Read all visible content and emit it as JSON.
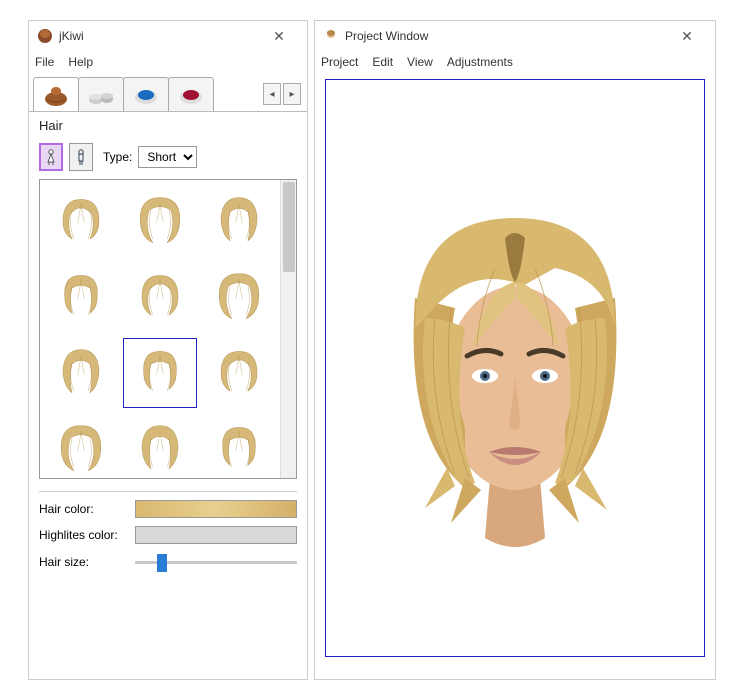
{
  "left": {
    "title": "jKiwi",
    "menu": {
      "file": "File",
      "help": "Help"
    },
    "tabs": [
      {
        "name": "hair-tab",
        "active": true
      },
      {
        "name": "foundation-tab",
        "active": false
      },
      {
        "name": "eyeshadow-tab",
        "active": false
      },
      {
        "name": "lipstick-tab",
        "active": false
      }
    ],
    "section_label": "Hair",
    "gender": {
      "female_selected": true,
      "male_selected": false
    },
    "type_label": "Type:",
    "type_value": "Short",
    "gallery": {
      "items": [
        {
          "id": "hair-01",
          "selected": false
        },
        {
          "id": "hair-02",
          "selected": false
        },
        {
          "id": "hair-03",
          "selected": false
        },
        {
          "id": "hair-04",
          "selected": false
        },
        {
          "id": "hair-05",
          "selected": false
        },
        {
          "id": "hair-06",
          "selected": false
        },
        {
          "id": "hair-07",
          "selected": false
        },
        {
          "id": "hair-08",
          "selected": true
        },
        {
          "id": "hair-09",
          "selected": false
        },
        {
          "id": "hair-10",
          "selected": false
        },
        {
          "id": "hair-11",
          "selected": false
        },
        {
          "id": "hair-12",
          "selected": false
        }
      ]
    },
    "hair_color_label": "Hair color:",
    "highlights_label": "Highlites color:",
    "hair_size_label": "Hair size:"
  },
  "right": {
    "title": "Project Window",
    "menu": {
      "project": "Project",
      "edit": "Edit",
      "view": "View",
      "adjustments": "Adjustments"
    }
  },
  "colors": {
    "accent": "#2a7dd4",
    "select_border": "#2020c0",
    "hair_blonde": "#d9b96f"
  }
}
